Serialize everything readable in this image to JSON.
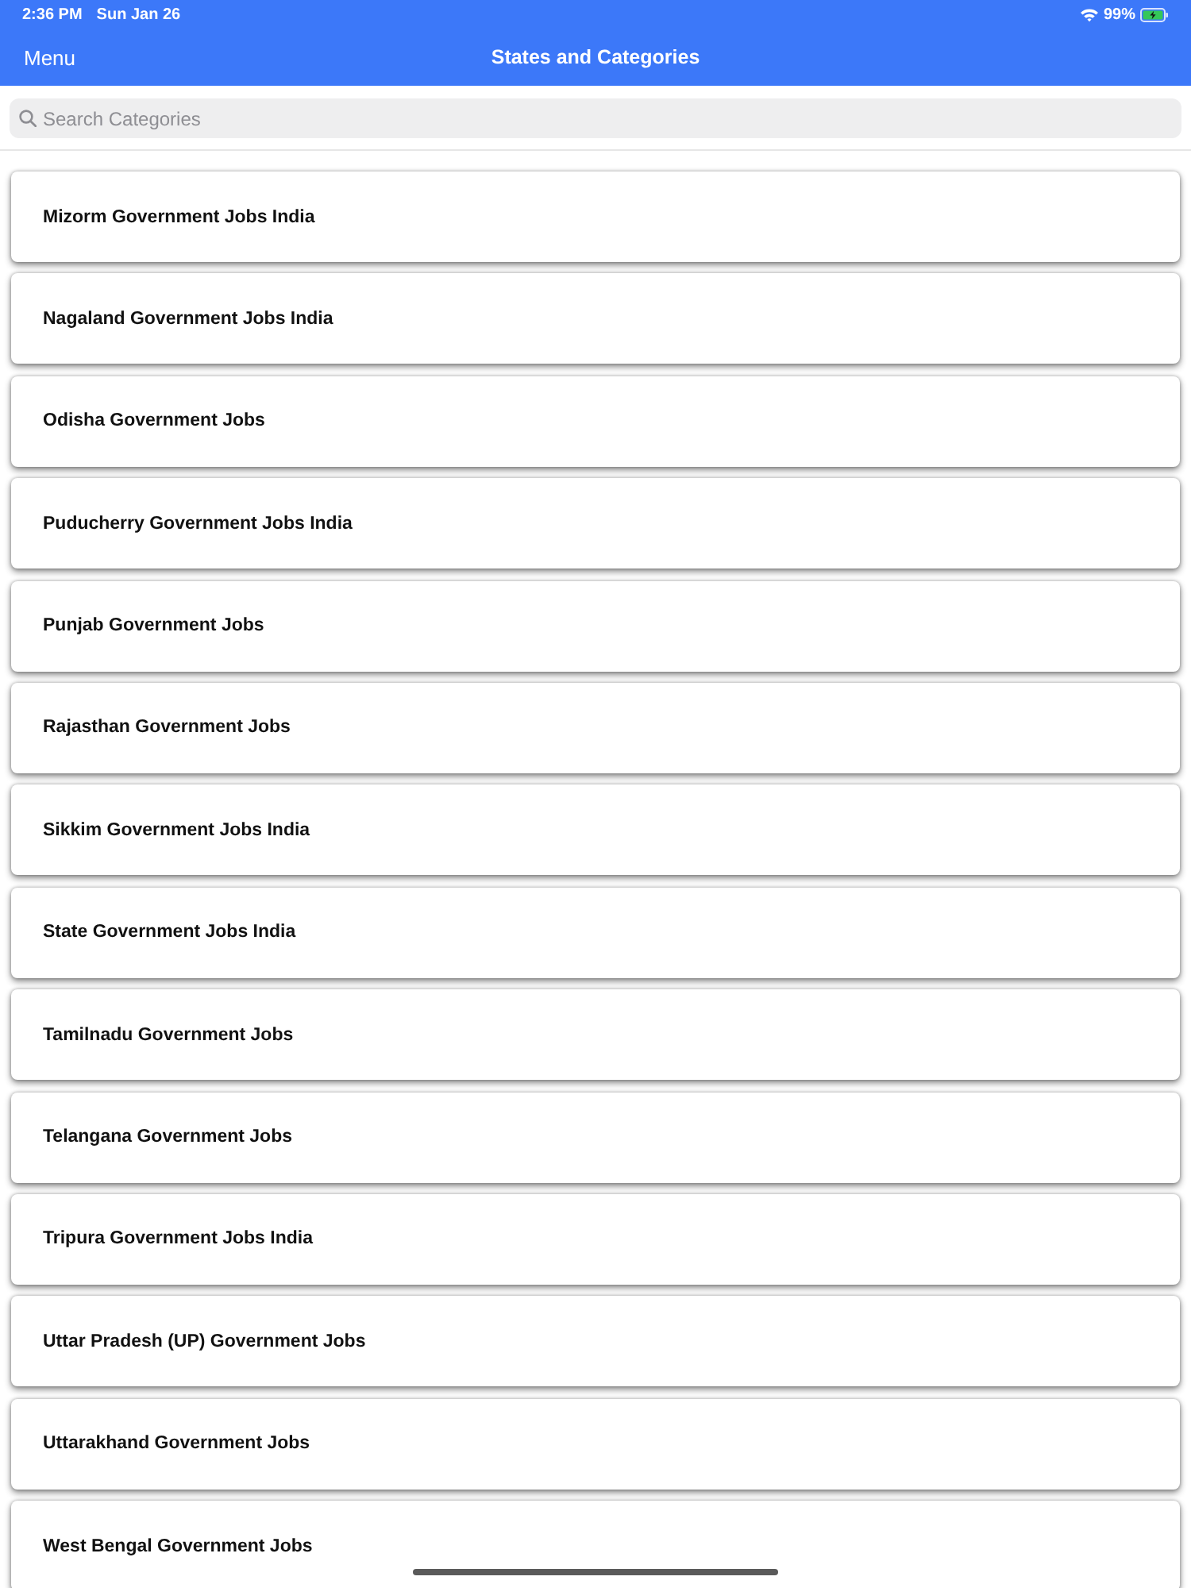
{
  "status_bar": {
    "time": "2:36 PM",
    "date": "Sun Jan 26",
    "battery": "99%"
  },
  "nav_bar": {
    "menu": "Menu",
    "title": "States and Categories"
  },
  "search": {
    "placeholder": "Search Categories"
  },
  "categories": [
    {
      "label": "Mizorm Government Jobs India"
    },
    {
      "label": "Nagaland Government Jobs India"
    },
    {
      "label": "Odisha Government Jobs"
    },
    {
      "label": "Puducherry Government Jobs India"
    },
    {
      "label": "Punjab Government Jobs"
    },
    {
      "label": "Rajasthan Government Jobs"
    },
    {
      "label": "Sikkim Government Jobs India"
    },
    {
      "label": "State Government Jobs India"
    },
    {
      "label": "Tamilnadu Government Jobs"
    },
    {
      "label": "Telangana Government Jobs"
    },
    {
      "label": "Tripura Government Jobs India"
    },
    {
      "label": "Uttar Pradesh (UP) Government Jobs"
    },
    {
      "label": "Uttarakhand Government Jobs"
    },
    {
      "label": "West Bengal Government Jobs"
    }
  ]
}
